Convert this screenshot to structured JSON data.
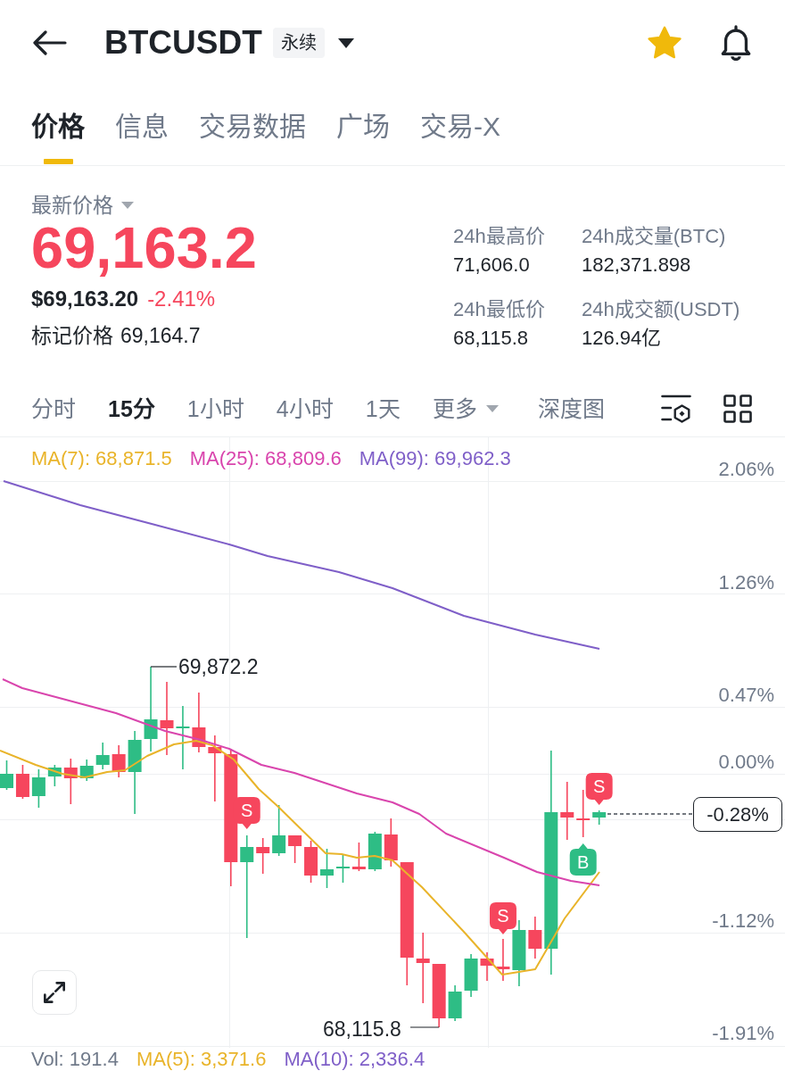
{
  "header": {
    "symbol": "BTCUSDT",
    "contract_badge": "永续",
    "favorited": true
  },
  "tabs": [
    {
      "label": "价格",
      "selected": true
    },
    {
      "label": "信息",
      "selected": false
    },
    {
      "label": "交易数据",
      "selected": false
    },
    {
      "label": "广场",
      "selected": false
    },
    {
      "label": "交易-X",
      "selected": false
    }
  ],
  "price": {
    "label": "最新价格",
    "last": "69,163.2",
    "usd": "$69,163.20",
    "change": "-2.41%",
    "mark_label": "标记价格",
    "mark_value": "69,164.7"
  },
  "stats": [
    {
      "label": "24h最高价",
      "value": "71,606.0"
    },
    {
      "label": "24h成交量(BTC)",
      "value": "182,371.898"
    },
    {
      "label": "24h最低价",
      "value": "68,115.8"
    },
    {
      "label": "24h成交额(USDT)",
      "value": "126.94亿"
    }
  ],
  "intervals": [
    {
      "label": "分时",
      "selected": false
    },
    {
      "label": "15分",
      "selected": true
    },
    {
      "label": "1小时",
      "selected": false
    },
    {
      "label": "4小时",
      "selected": false
    },
    {
      "label": "1天",
      "selected": false
    }
  ],
  "more_menu": "更多",
  "depth_chart": "深度图",
  "chart": {
    "ma_legend": [
      {
        "label": "MA(7): 68,871.5",
        "color": "#e9b42a"
      },
      {
        "label": "MA(25): 68,809.6",
        "color": "#d945ad"
      },
      {
        "label": "MA(99): 69,962.3",
        "color": "#7f5fc8"
      }
    ],
    "axis_labels": [
      "2.06%",
      "1.26%",
      "0.47%",
      "0.00%",
      "-1.12%",
      "-1.91%"
    ],
    "high_label": "69,872.2",
    "low_label": "68,115.8",
    "price_tag": "-0.28%",
    "markers": [
      {
        "kind": "sell",
        "label": "S"
      },
      {
        "kind": "sell",
        "label": "S"
      },
      {
        "kind": "buy",
        "label": "B"
      },
      {
        "kind": "sell",
        "label": "S"
      }
    ]
  },
  "volume_legend": [
    {
      "label": "Vol: 191.4",
      "color": "#707a8a"
    },
    {
      "label": "MA(5): 3,371.6",
      "color": "#e9b42a"
    },
    {
      "label": "MA(10): 2,336.4",
      "color": "#7f5fc8"
    }
  ]
}
